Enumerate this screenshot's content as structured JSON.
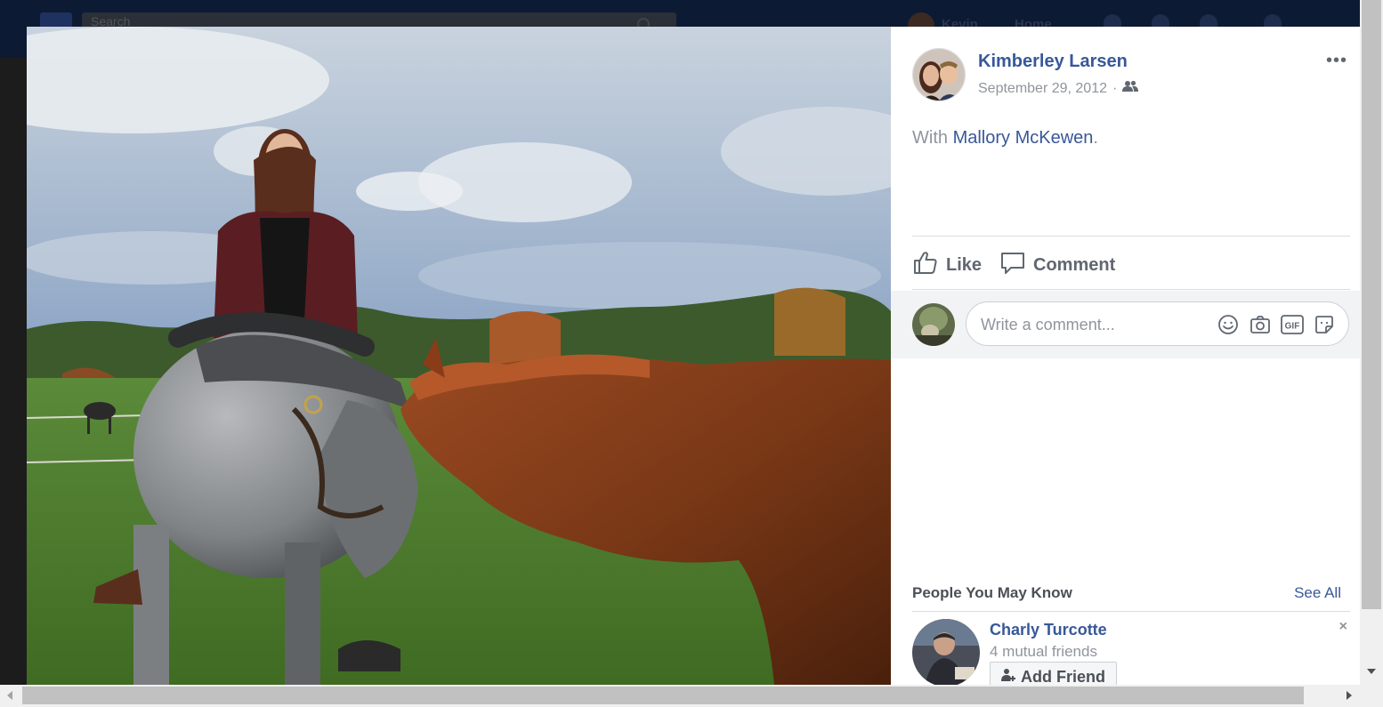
{
  "topbar": {
    "search_placeholder": "Search",
    "user_name": "Kevin",
    "home_label": "Home"
  },
  "post": {
    "author": "Kimberley Larsen",
    "date": "September 29, 2012",
    "date_separator": "·",
    "audience_icon": "friends-icon",
    "more_label": "•••",
    "with_prefix": "With ",
    "tagged_person": "Mallory McKewen",
    "with_suffix": "."
  },
  "actions": {
    "like_label": "Like",
    "comment_label": "Comment"
  },
  "comment_box": {
    "placeholder": "Write a comment...",
    "icons": [
      "emoji-icon",
      "camera-icon",
      "gif-icon",
      "sticker-icon"
    ],
    "gif_text": "GIF"
  },
  "pymk": {
    "title": "People You May Know",
    "see_all": "See All",
    "person": {
      "name": "Charly Turcotte",
      "mutual": "4 mutual friends",
      "add_label": "Add Friend",
      "close": "×"
    }
  },
  "colors": {
    "link": "#385898",
    "muted": "#90949c",
    "action": "#606770"
  }
}
